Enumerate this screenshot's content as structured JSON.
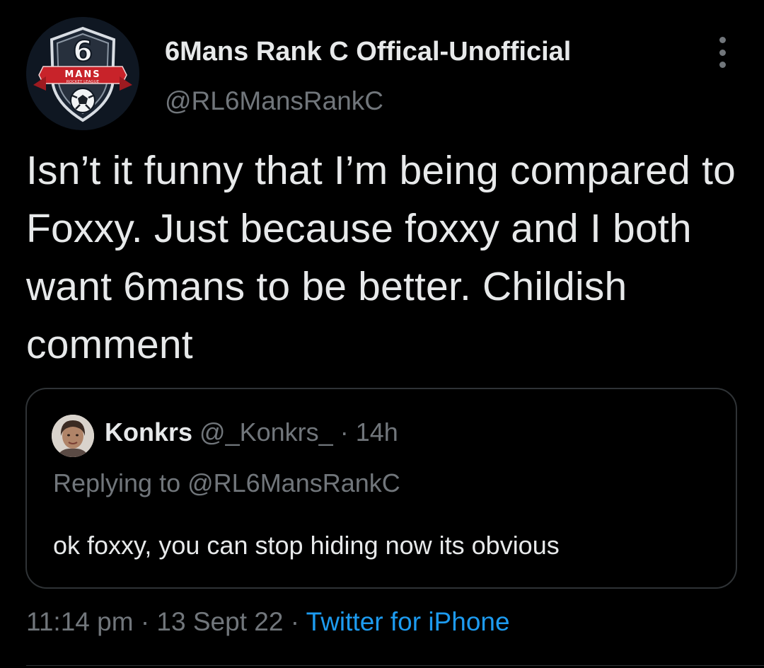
{
  "tweet": {
    "author": {
      "name": "6Mans Rank C Offical-Unofficial",
      "handle": "@RL6MansRankC",
      "avatar_icon": "6mans-logo-icon",
      "logo_text": "6",
      "logo_banner": "MANS",
      "logo_subtext": "ROCKET LEAGUE"
    },
    "more_icon": "more-vertical-icon",
    "text": "Isn’t it funny that I’m being compared to Foxxy. Just because foxxy and I both want 6mans to be better. Childish comment",
    "quoted": {
      "name": "Konkrs",
      "handle": "@_Konkrs_",
      "separator": "·",
      "time": "14h",
      "replying_to": "Replying to @RL6MansRankC",
      "text": "ok foxxy, you can stop hiding now its obvious"
    },
    "footer": {
      "time": "11:14 pm",
      "sep1": "·",
      "date": "13 Sept 22",
      "sep2": "·",
      "source": "Twitter for iPhone"
    }
  },
  "colors": {
    "background": "#000000",
    "text": "#e7e9ea",
    "muted": "#71767b",
    "link": "#1d9bf0",
    "border": "#2f3336"
  }
}
